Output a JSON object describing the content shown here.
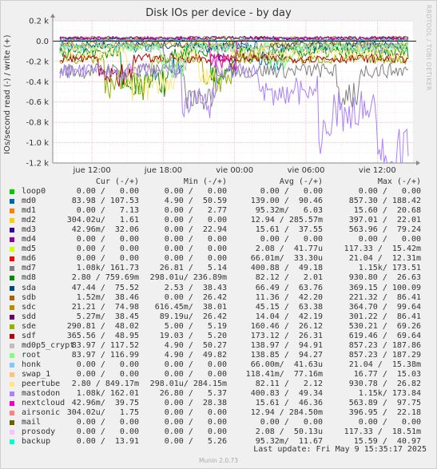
{
  "chart_data": {
    "type": "line",
    "title": "Disk IOs per device - by day",
    "ylabel": "IOs/second read (-) / write (+)",
    "side_label": "RRDTOOL / TOBI OETIKER",
    "ylim": [
      -1200,
      200
    ],
    "yticks": [
      {
        "v": 200,
        "label": "0.2 k"
      },
      {
        "v": 0,
        "label": "0.0"
      },
      {
        "v": -200,
        "label": "-0.2 k"
      },
      {
        "v": -400,
        "label": "-0.4 k"
      },
      {
        "v": -600,
        "label": "-0.6 k"
      },
      {
        "v": -800,
        "label": "-0.8 k"
      },
      {
        "v": -1000,
        "label": "-1.0 k"
      },
      {
        "v": -1200,
        "label": "-1.2 k"
      }
    ],
    "xticks": [
      {
        "t": 12,
        "label": "jue 12:00"
      },
      {
        "t": 18,
        "label": "jue 18:00"
      },
      {
        "t": 24,
        "label": "vie 00:00"
      },
      {
        "t": 30,
        "label": "vie 06:00"
      },
      {
        "t": 36,
        "label": "vie 12:00"
      }
    ],
    "xlim": [
      8.7,
      39.0
    ],
    "grid": true,
    "columns": [
      "Cur (-/+)",
      "Min (-/+)",
      "Avg (-/+)",
      "Max (-/+)"
    ],
    "series": [
      {
        "name": "loop0",
        "color": "#00cc00",
        "cur": "0.00 /   0.00",
        "min": "0.00 /   0.00",
        "avg": "0.00 /   0.00",
        "max": "0.00 /   0.00"
      },
      {
        "name": "md0",
        "color": "#0066b3",
        "cur": "83.98 / 107.53",
        "min": "4.90 /  50.59",
        "avg": "139.00 /  90.46",
        "max": "857.30 / 188.42"
      },
      {
        "name": "md1",
        "color": "#ff8000",
        "cur": "0.00 /   7.13",
        "min": "0.00 /   2.77",
        "avg": "95.32m/   6.03",
        "max": "15.60 /  20.68"
      },
      {
        "name": "md2",
        "color": "#ffcc00",
        "cur": "304.02u/   1.61",
        "min": "0.00 /   0.00",
        "avg": "12.94 / 285.57m",
        "max": "397.01 /  22.01"
      },
      {
        "name": "md3",
        "color": "#330099",
        "cur": "42.96m/  32.06",
        "min": "0.00 /  22.94",
        "avg": "15.61 /  37.55",
        "max": "563.96 /  79.24"
      },
      {
        "name": "md4",
        "color": "#990099",
        "cur": "0.00 /   0.00",
        "min": "0.00 /   0.00",
        "avg": "0.00 /   0.00",
        "max": "0.00 /   0.00"
      },
      {
        "name": "md5",
        "color": "#ccff00",
        "cur": "0.00 /   0.00",
        "min": "0.00 /   0.00",
        "avg": "2.08 /  41.77u",
        "max": "117.33 /  15.42m"
      },
      {
        "name": "md6",
        "color": "#ff0000",
        "cur": "0.00 /   0.00",
        "min": "0.00 /   0.00",
        "avg": "66.01m/  33.30u",
        "max": "21.04 /  12.31m"
      },
      {
        "name": "md7",
        "color": "#808080",
        "cur": "1.08k/ 161.73",
        "min": "26.81 /   5.14",
        "avg": "400.88 /  49.18",
        "max": "1.15k/ 173.51"
      },
      {
        "name": "md8",
        "color": "#008f00",
        "cur": "2.80 / 759.69m",
        "min": "298.01u/ 236.89m",
        "avg": "82.12 /   2.01",
        "max": "930.80 /  26.63"
      },
      {
        "name": "sda",
        "color": "#00487d",
        "cur": "47.44 /  75.52",
        "min": "2.53 /  38.43",
        "avg": "66.49 /  63.76",
        "max": "369.15 / 100.09"
      },
      {
        "name": "sdb",
        "color": "#b35a00",
        "cur": "1.52m/  38.46",
        "min": "0.00 /  26.42",
        "avg": "11.36 /  42.20",
        "max": "221.32 /  86.41"
      },
      {
        "name": "sdc",
        "color": "#b38f00",
        "cur": "21.21 /  74.98",
        "min": "616.45m/  38.01",
        "avg": "45.15 /  63.38",
        "max": "364.70 /  99.64"
      },
      {
        "name": "sdd",
        "color": "#6b006b",
        "cur": "5.27m/  38.45",
        "min": "89.19u/  26.42",
        "avg": "14.04 /  42.19",
        "max": "301.22 /  86.41"
      },
      {
        "name": "sde",
        "color": "#8fb300",
        "cur": "290.81 /  48.02",
        "min": "5.00 /   5.19",
        "avg": "160.46 /  26.12",
        "max": "530.21 /  69.26"
      },
      {
        "name": "sdf",
        "color": "#b30000",
        "cur": "365.56 /  48.95",
        "min": "19.03 /   5.20",
        "avg": "173.12 /  26.31",
        "max": "619.46 /  69.64"
      },
      {
        "name": "md0p5_crypt",
        "color": "#bebebe",
        "cur": "83.97 / 117.52",
        "min": "4.90 /  50.27",
        "avg": "138.97 /  94.91",
        "max": "857.23 / 187.86"
      },
      {
        "name": "root",
        "color": "#80ff80",
        "cur": "83.97 / 116.99",
        "min": "4.90 /  49.82",
        "avg": "138.85 /  94.27",
        "max": "857.23 / 187.29"
      },
      {
        "name": "honk",
        "color": "#80c9ff",
        "cur": "0.00 /   0.00",
        "min": "0.00 /   0.00",
        "avg": "66.00m/  41.63u",
        "max": "21.04 /  15.38m"
      },
      {
        "name": "swap_1",
        "color": "#ffc080",
        "cur": "0.00 /   0.00",
        "min": "0.00 /   0.00",
        "avg": "118.41m/  77.16m",
        "max": "16.77 /  15.03"
      },
      {
        "name": "peertube",
        "color": "#ffe680",
        "cur": "2.80 / 849.17m",
        "min": "298.01u/ 284.15m",
        "avg": "82.11 /   2.12",
        "max": "930.78 /  26.82"
      },
      {
        "name": "mastodon",
        "color": "#aa80ff",
        "cur": "1.08k/ 162.01",
        "min": "26.80 /   5.37",
        "avg": "400.83 /  49.34",
        "max": "1.15k/ 173.84"
      },
      {
        "name": "nextcloud",
        "color": "#ee00cc",
        "cur": "42.96m/  39.75",
        "min": "0.00 /  28.38",
        "avg": "15.61 /  46.36",
        "max": "563.89 /  97.75"
      },
      {
        "name": "airsonic",
        "color": "#ff8080",
        "cur": "304.02u/   1.75",
        "min": "0.00 /   0.00",
        "avg": "12.94 / 284.50m",
        "max": "396.95 /  22.18"
      },
      {
        "name": "mail",
        "color": "#666600",
        "cur": "0.00 /   0.00",
        "min": "0.00 /   0.00",
        "avg": "0.00 /   0.00",
        "max": "0.00 /   0.00"
      },
      {
        "name": "prosody",
        "color": "#ffbfff",
        "cur": "0.00 /   0.00",
        "min": "0.00 /   0.00",
        "avg": "2.08 /  50.13u",
        "max": "117.33 /  18.51m"
      },
      {
        "name": "backup",
        "color": "#00ffcc",
        "cur": "0.00 /  13.91",
        "min": "0.00 /   5.26",
        "avg": "95.32m/  11.67",
        "max": "15.59 /  40.97"
      }
    ]
  },
  "footer": {
    "last_update": "Last update:  Fri May  9 15:35:17 2025",
    "munin": "Munin 2.0.73"
  }
}
